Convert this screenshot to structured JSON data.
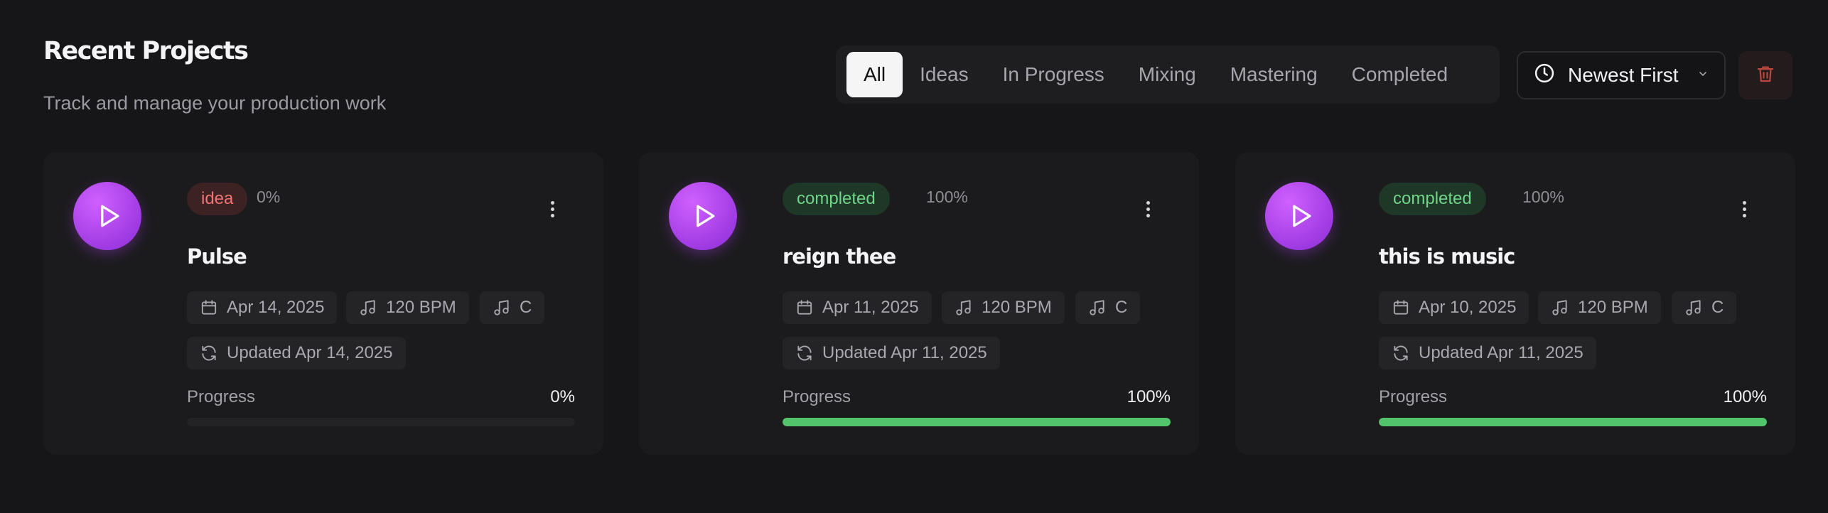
{
  "header": {
    "title": "Recent Projects",
    "subtitle": "Track and manage your production work"
  },
  "filters": {
    "tabs": [
      "All",
      "Ideas",
      "In Progress",
      "Mixing",
      "Mastering",
      "Completed"
    ],
    "active": "All"
  },
  "sort": {
    "label": "Newest First",
    "icon": "clock-icon"
  },
  "delete": {
    "icon": "trash-icon",
    "color": "#b9463f"
  },
  "progress_label": "Progress",
  "projects": [
    {
      "status": "idea",
      "percent": "0%",
      "name": "Pulse",
      "date": "Apr 14, 2025",
      "bpm": "120 BPM",
      "key": "C",
      "updated": "Updated Apr 14, 2025",
      "progress_value": "0%",
      "progress": 0
    },
    {
      "status": "completed",
      "percent": "100%",
      "name": "reign thee",
      "date": "Apr 11, 2025",
      "bpm": "120 BPM",
      "key": "C",
      "updated": "Updated Apr 11, 2025",
      "progress_value": "100%",
      "progress": 1
    },
    {
      "status": "completed",
      "percent": "100%",
      "name": "this is music",
      "date": "Apr 10, 2025",
      "bpm": "120 BPM",
      "key": "C",
      "updated": "Updated Apr 11, 2025",
      "progress_value": "100%",
      "progress": 1
    }
  ],
  "colors": {
    "accent_purple": "#a640e6",
    "completed_green": "#52c46c",
    "idea_red": "#f07474"
  }
}
